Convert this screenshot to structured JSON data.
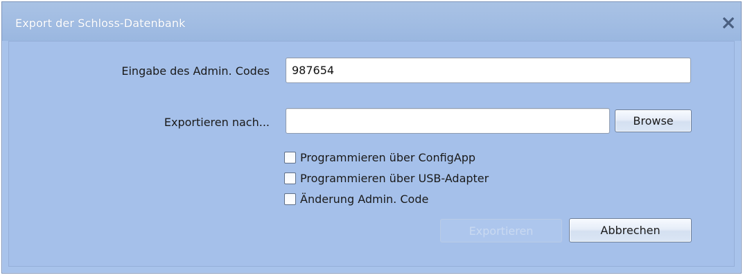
{
  "window": {
    "title": "Export der Schloss-Datenbank",
    "close_icon": "close-icon"
  },
  "form": {
    "admin_code_label": "Eingabe des Admin. Codes",
    "admin_code_value": "987654",
    "export_to_label": "Exportieren nach...",
    "export_to_value": "",
    "browse_label": "Browse"
  },
  "options": [
    {
      "label": "Programmieren über ConfigApp",
      "checked": false
    },
    {
      "label": "Programmieren über USB-Adapter",
      "checked": false
    },
    {
      "label": "Änderung Admin. Code",
      "checked": false
    }
  ],
  "actions": {
    "export_label": "Exportieren",
    "export_enabled": false,
    "cancel_label": "Abbrechen"
  },
  "colors": {
    "window_bg": "#a8c3eb",
    "title_text": "#ffffff",
    "close_glyph": "#4a5f80"
  }
}
